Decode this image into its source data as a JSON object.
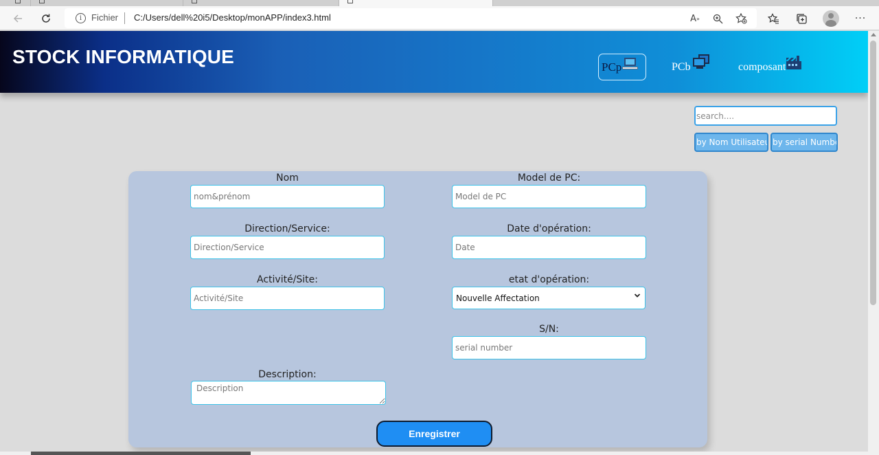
{
  "browser": {
    "scheme_label": "Fichier",
    "address": "C:/Users/dell%20i5/Desktop/monAPP/index3.html",
    "nav_icons": {
      "back": "arrow-left-icon",
      "reload": "reload-icon"
    },
    "address_icons": [
      "read-aloud-icon",
      "zoom-icon",
      "add-favorite-icon"
    ],
    "toolbar_icons": [
      "favorites-icon",
      "collections-icon",
      "profile-avatar",
      "more-icon"
    ]
  },
  "header": {
    "brand": "STOCK INFORMATIQUE",
    "nav": [
      {
        "label": "PCp",
        "icon": "laptop-icon",
        "active": true
      },
      {
        "label": "PCb",
        "icon": "desktop-icon",
        "active": false
      },
      {
        "label": "composant",
        "icon": "factory-icon",
        "active": false
      }
    ]
  },
  "search": {
    "placeholder": "search....",
    "filters": [
      "by Nom Utilisateur",
      "by serial Number"
    ]
  },
  "form": {
    "nom": {
      "label": "Nom",
      "placeholder": "nom&prénom"
    },
    "direction": {
      "label": "Direction/Service:",
      "placeholder": "Direction/Service"
    },
    "activite": {
      "label": "Activité/Site:",
      "placeholder": "Activité/Site"
    },
    "description": {
      "label": "Description:",
      "placeholder": "Description"
    },
    "model": {
      "label": "Model de PC:",
      "placeholder": "Model de PC"
    },
    "date": {
      "label": "Date d'opération:",
      "placeholder": "Date"
    },
    "etat": {
      "label": "etat d'opération:",
      "selected": "Nouvelle Affectation"
    },
    "sn": {
      "label": "S/N:",
      "placeholder": "serial number"
    },
    "submit_label": "Enregistrer"
  },
  "colors": {
    "header_gradient": [
      "#06061c",
      "#0b2f88",
      "#1676c8",
      "#00cff7"
    ],
    "card_bg": "#b7c6de",
    "input_border": "#3cc2e8",
    "submit_bg": "#1f8ef3",
    "page_bg": "#dcdcdc"
  }
}
